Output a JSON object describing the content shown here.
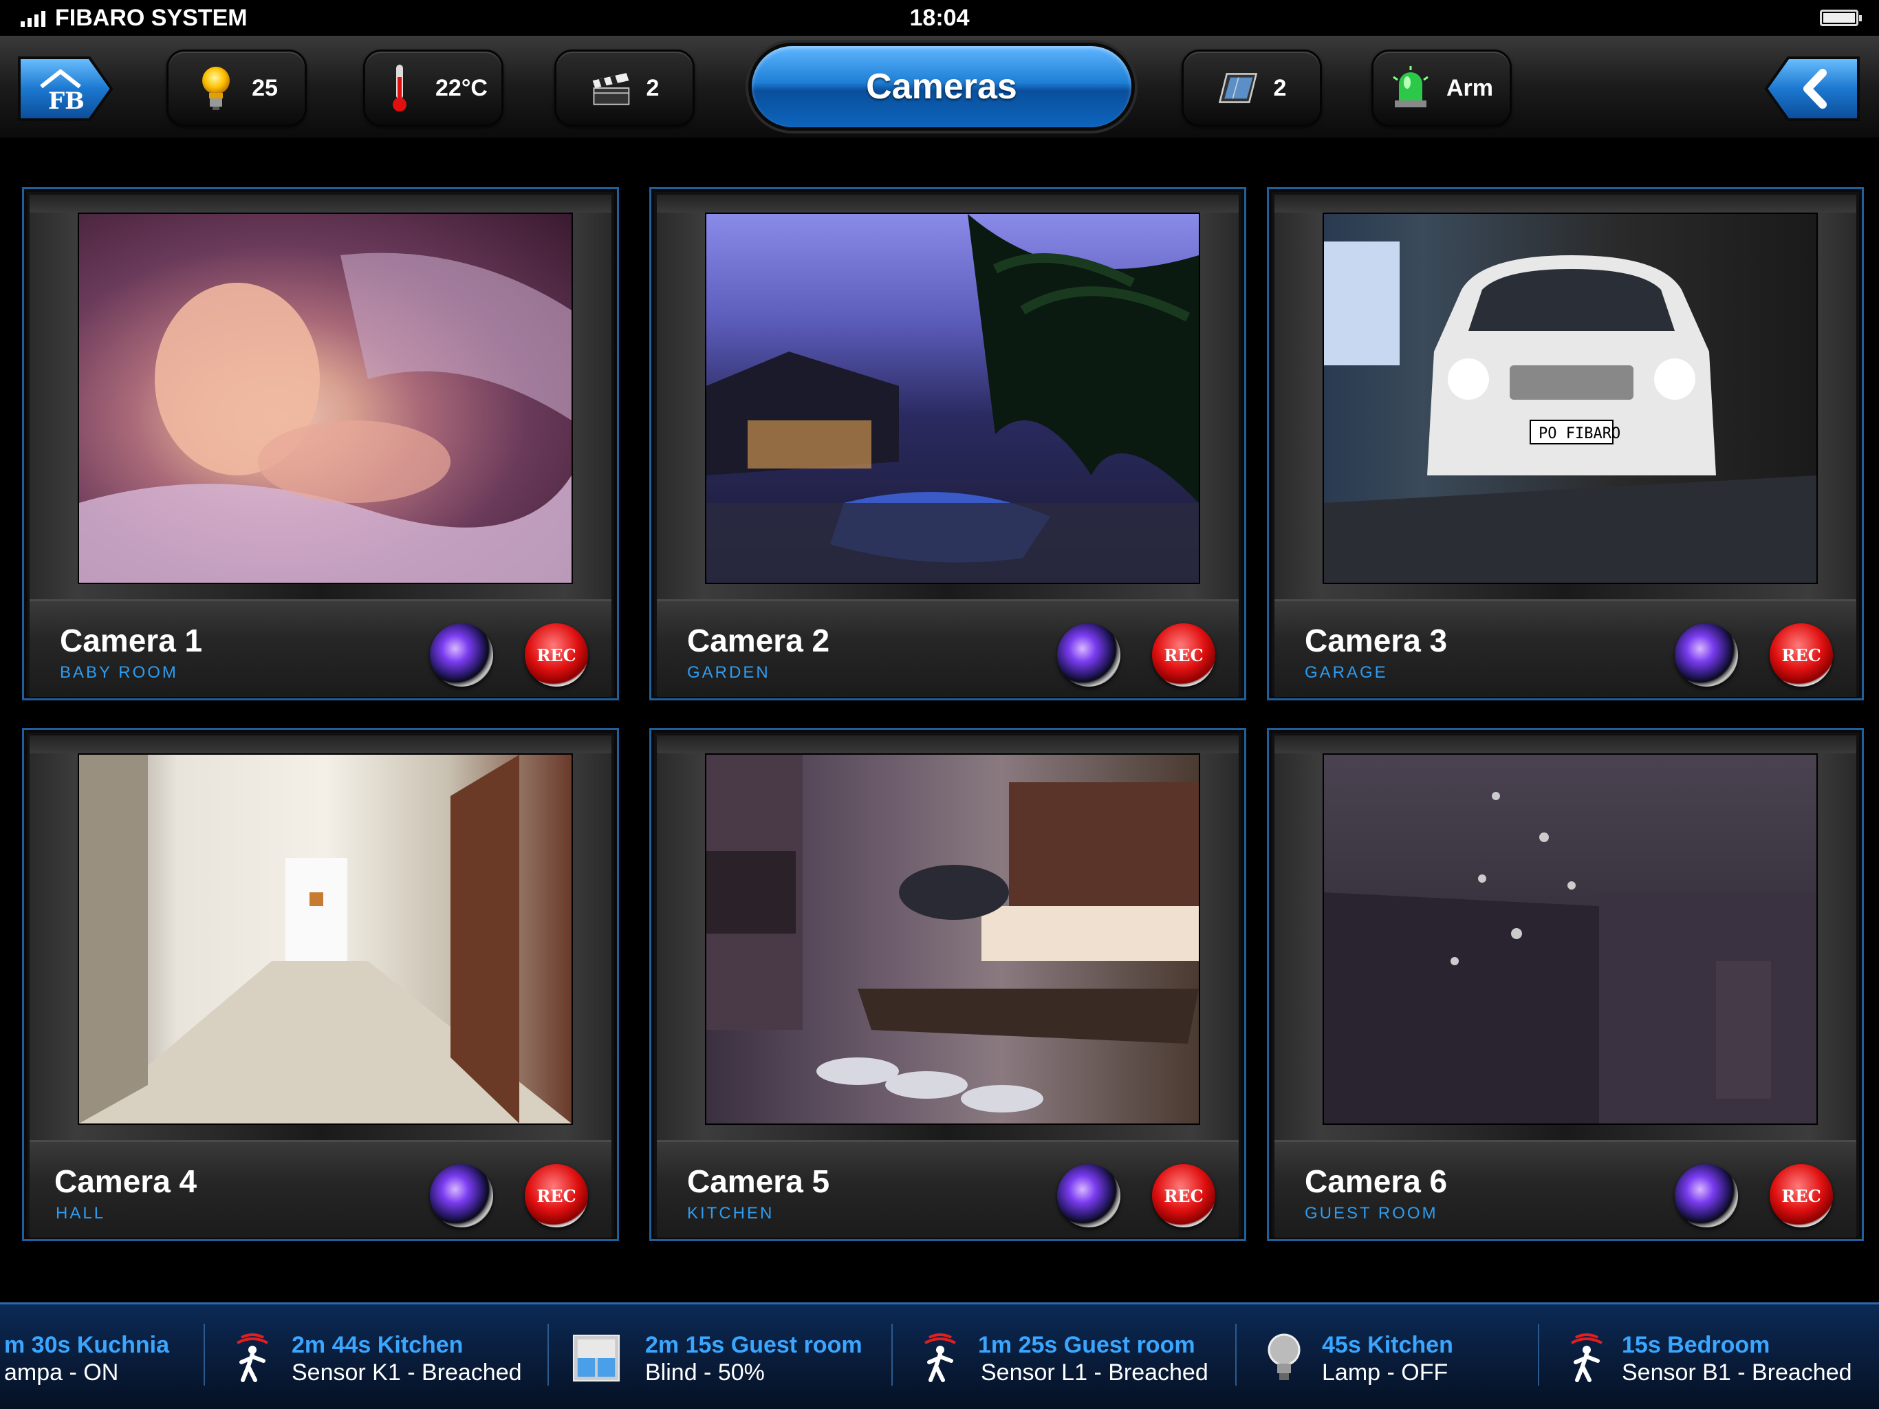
{
  "status_bar": {
    "carrier": "FIBARO SYSTEM",
    "time": "18:04"
  },
  "toolbar": {
    "lights_count": "25",
    "temperature": "22°C",
    "scenes_count": "2",
    "title": "Cameras",
    "blinds_count": "2",
    "alarm_label": "Arm"
  },
  "cameras": [
    {
      "name": "Camera 1",
      "room": "BABY ROOM"
    },
    {
      "name": "Camera 2",
      "room": "GARDEN"
    },
    {
      "name": "Camera 3",
      "room": "GARAGE"
    },
    {
      "name": "Camera 4",
      "room": "HALL"
    },
    {
      "name": "Camera 5",
      "room": "KITCHEN"
    },
    {
      "name": "Camera 6",
      "room": "GUEST ROOM"
    }
  ],
  "rec_label": "REC",
  "license_plate": "PO FIBARO",
  "events": [
    {
      "title": "m 30s Kuchnia",
      "desc": "ampa - ON",
      "icon": "lamp-icon"
    },
    {
      "title": "2m 44s Kitchen",
      "desc": "Sensor K1 - Breached",
      "icon": "motion-sensor-icon"
    },
    {
      "title": "2m 15s Guest room",
      "desc": "Blind  - 50%",
      "icon": "blind-icon"
    },
    {
      "title": "1m 25s Guest room",
      "desc": "Sensor L1 - Breached",
      "icon": "motion-sensor-icon"
    },
    {
      "title": "45s Kitchen",
      "desc": "Lamp - OFF",
      "icon": "lamp-icon"
    },
    {
      "title": "15s Bedroom",
      "desc": "Sensor B1 - Breached",
      "icon": "motion-sensor-icon"
    }
  ],
  "colors": {
    "accent_blue": "#2e9cf0",
    "rec_red": "#e01010",
    "ticker_title": "#3aa6ff"
  }
}
